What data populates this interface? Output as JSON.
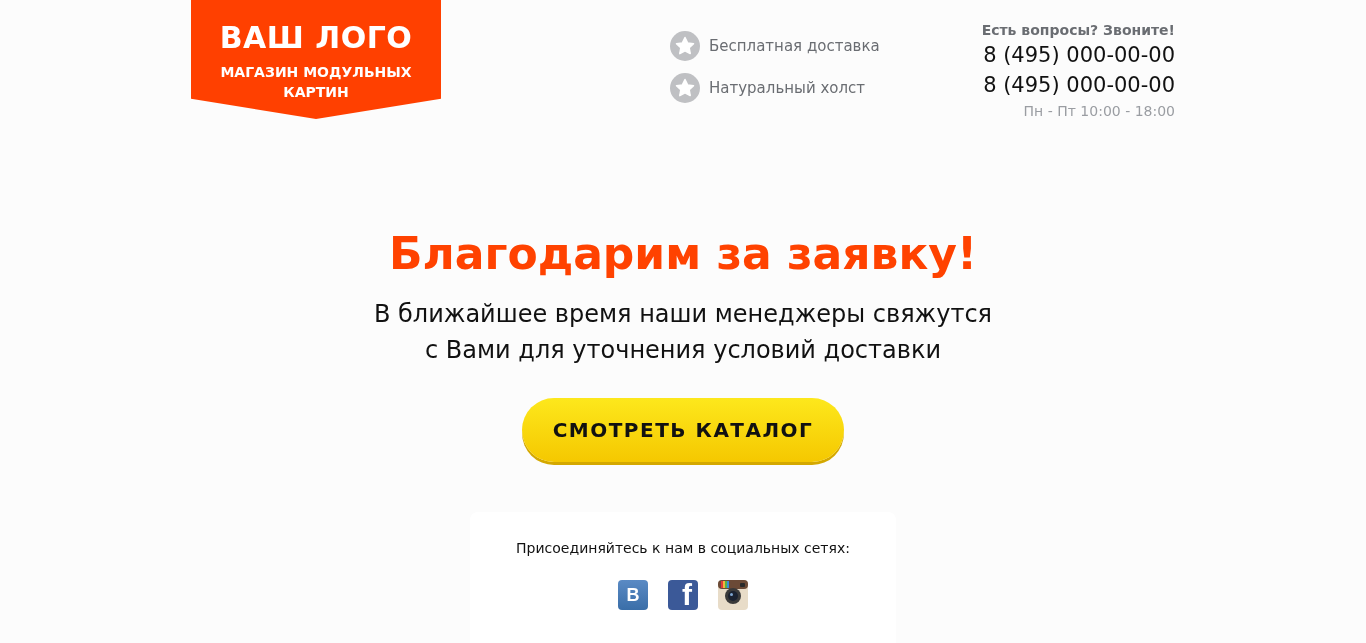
{
  "logo": {
    "title": "ВАШ ЛОГО",
    "subtitle": "МАГАЗИН МОДУЛЬНЫХ КАРТИН"
  },
  "features": [
    "Бесплатная доставка",
    "Натуральный холст"
  ],
  "contacts": {
    "prompt": "Есть вопросы? Звоните!",
    "phones": [
      "8 (495) 000-00-00",
      "8 (495) 000-00-00"
    ],
    "hours": "Пн - Пт 10:00 - 18:00"
  },
  "heading": "Благодарим за заявку!",
  "message": [
    "В ближайшее время наши менеджеры свяжутся",
    "с Вами для уточнения условий доставки"
  ],
  "button": "СМОТРЕТЬ КАТАЛОГ",
  "social": {
    "caption": "Присоединяйтесь к нам в социальных сетях:",
    "links": [
      {
        "kind": "vk",
        "glyph": "В"
      },
      {
        "kind": "facebook",
        "glyph": "f"
      },
      {
        "kind": "instagram"
      }
    ]
  }
}
